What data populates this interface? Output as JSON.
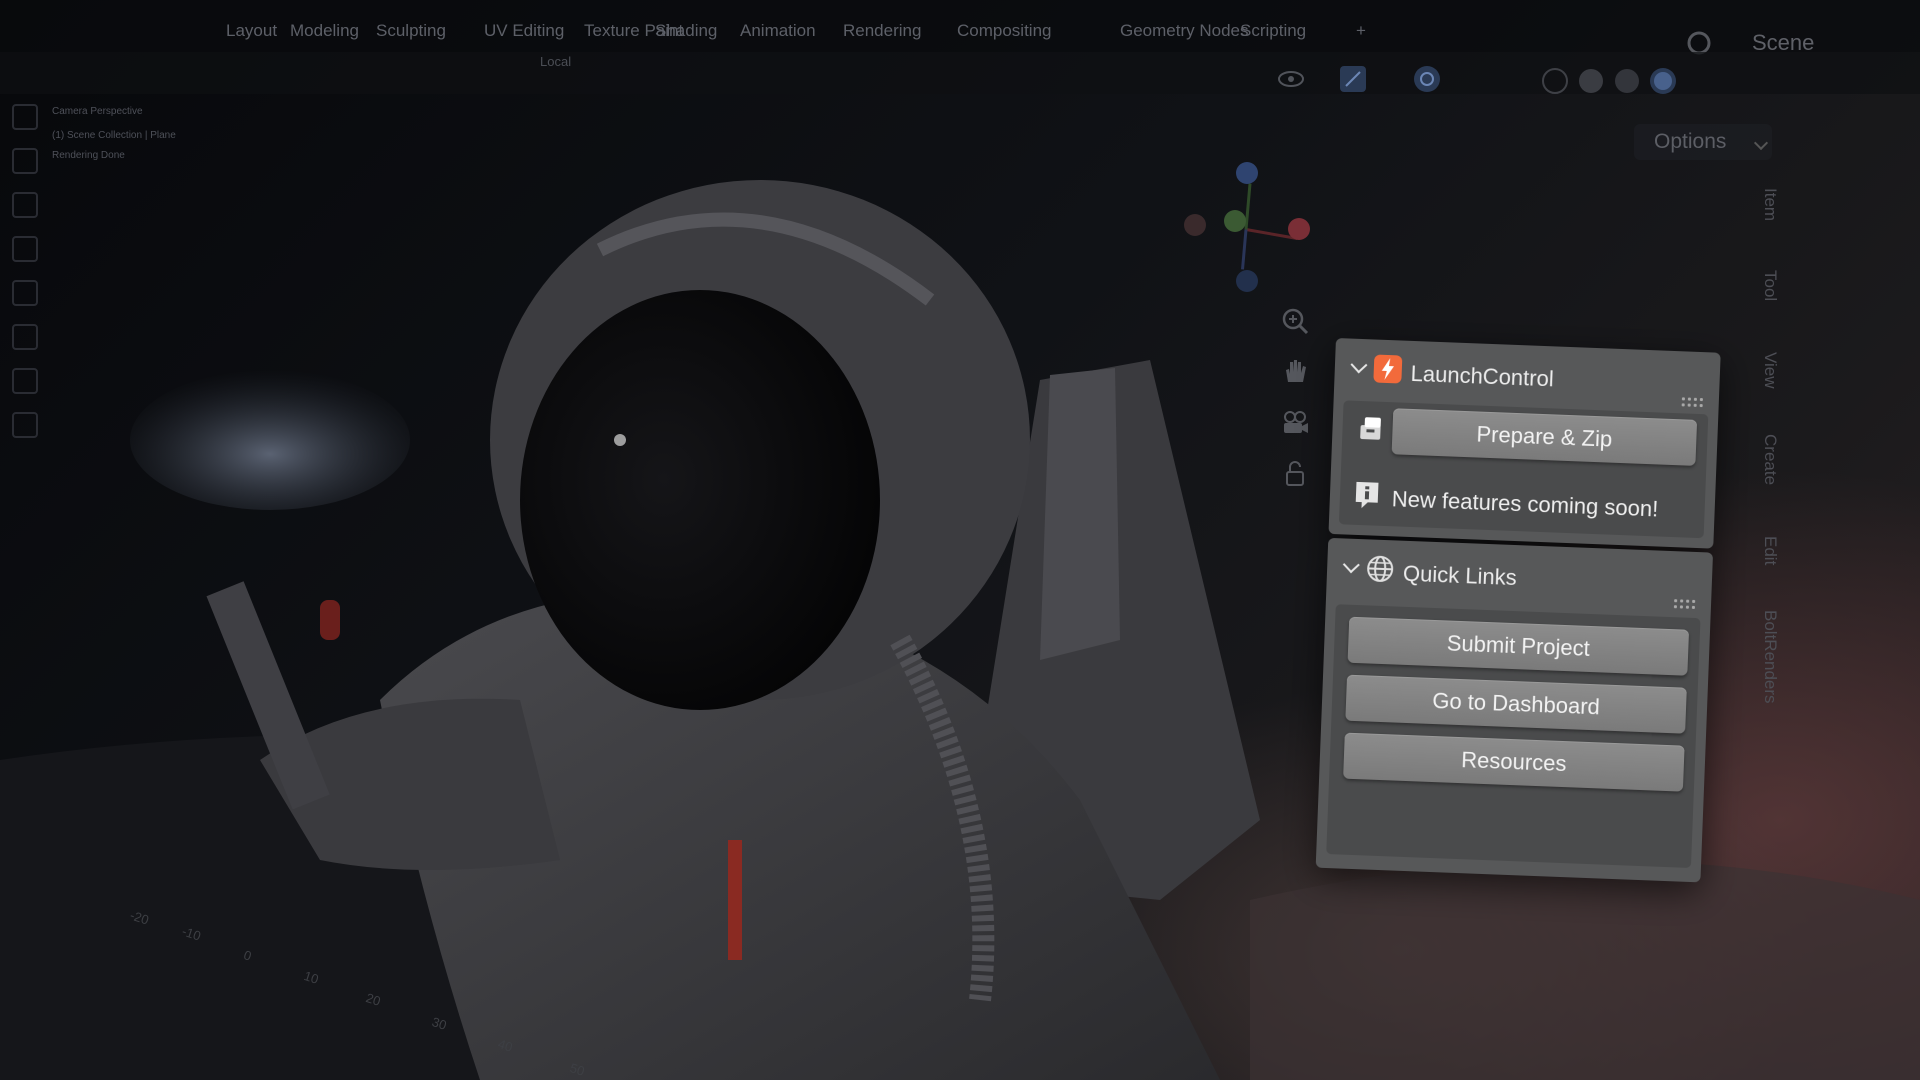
{
  "app": {
    "scene_label": "Scene",
    "options_label": "Options",
    "workspace_tabs": [
      "Layout",
      "Modeling",
      "Sculpting",
      "UV Editing",
      "Texture Paint",
      "Shading",
      "Animation",
      "Rendering",
      "Compositing",
      "Geometry Nodes",
      "Scripting",
      "+"
    ],
    "side_tabs": [
      "Item",
      "Tool",
      "View",
      "Create",
      "Edit",
      "BoltRenders"
    ]
  },
  "panel": {
    "launch": {
      "title": "LaunchControl",
      "button": "Prepare & Zip",
      "info": "New features coming soon!"
    },
    "quick": {
      "title": "Quick Links",
      "buttons": [
        "Submit Project",
        "Go to Dashboard",
        "Resources"
      ]
    }
  },
  "colors": {
    "accent": "#f26a3b",
    "panel_bg": "#575859",
    "button_bg": "#848484"
  },
  "icons": {
    "launch": "lightning-bolt-icon",
    "zip": "archive-icon",
    "info": "info-icon",
    "quick": "globe-icon"
  }
}
